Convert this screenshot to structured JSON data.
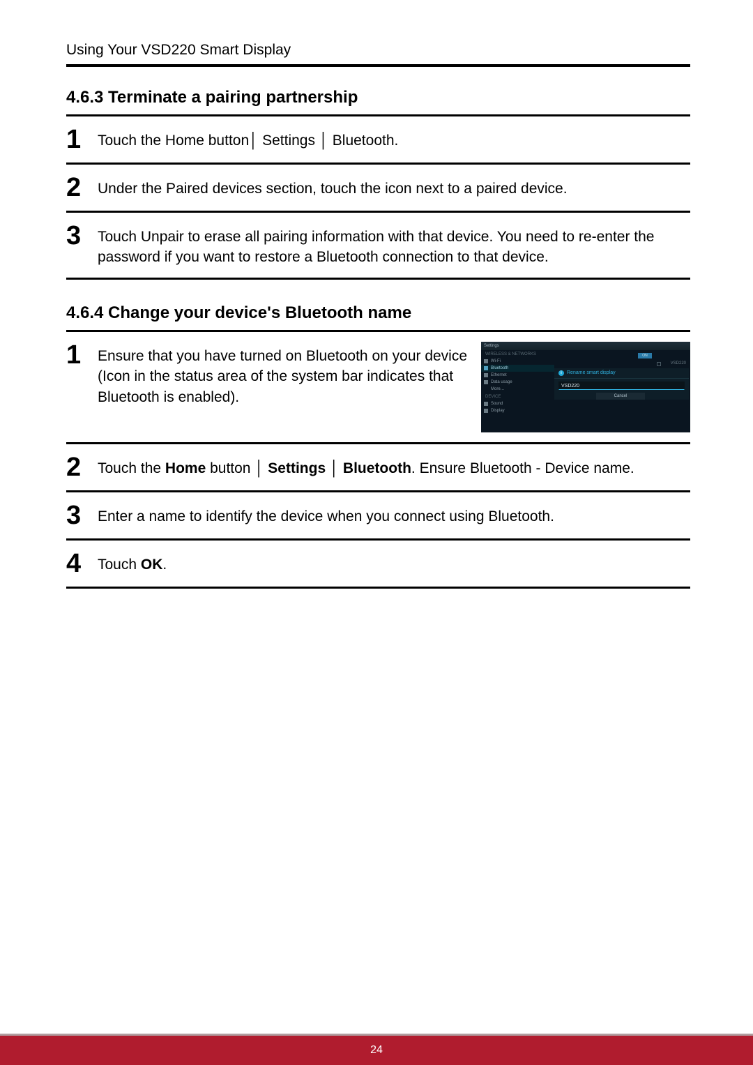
{
  "header": "Using Your VSD220 Smart Display",
  "section1": {
    "heading": "4.6.3  Terminate a pairing partnership",
    "steps": [
      "Touch the Home button│ Settings │ Bluetooth.",
      "Under the Paired devices section, touch the icon next to a paired device.",
      "Touch Unpair to erase all pairing information with that device. You need to re-enter the password if you want to restore a Bluetooth connection to that device."
    ]
  },
  "section2": {
    "heading": "4.6.4  Change your device's Bluetooth name",
    "step1_line1": "Ensure that you have turned on Bluetooth on your device",
    "step1_line2": "(Icon in the status area of the system bar indicates that Bluetooth is enabled).",
    "step2_pre": "Touch the ",
    "step2_home": "Home",
    "step2_mid1": " button │ ",
    "step2_settings": "Settings",
    "step2_mid2": " │ ",
    "step2_bt": "Bluetooth",
    "step2_post": ". Ensure Bluetooth - Device name.",
    "step3": "Enter a name to identify the device when you connect using Bluetooth.",
    "step4_pre": "Touch ",
    "step4_ok": "OK",
    "step4_post": "."
  },
  "screenshot": {
    "title": "Settings",
    "section_label": "WIRELESS & NETWORKS",
    "items": [
      "Wi-Fi",
      "Bluetooth",
      "Ethernet",
      "Data usage",
      "More…"
    ],
    "device_section": "DEVICE",
    "device_items": [
      "Sound",
      "Display"
    ],
    "on": "ON",
    "dev_name": "VSD220",
    "dialog_title": "Rename smart display",
    "input": "VSD220",
    "cancel": "Cancel"
  },
  "page_number": "24"
}
